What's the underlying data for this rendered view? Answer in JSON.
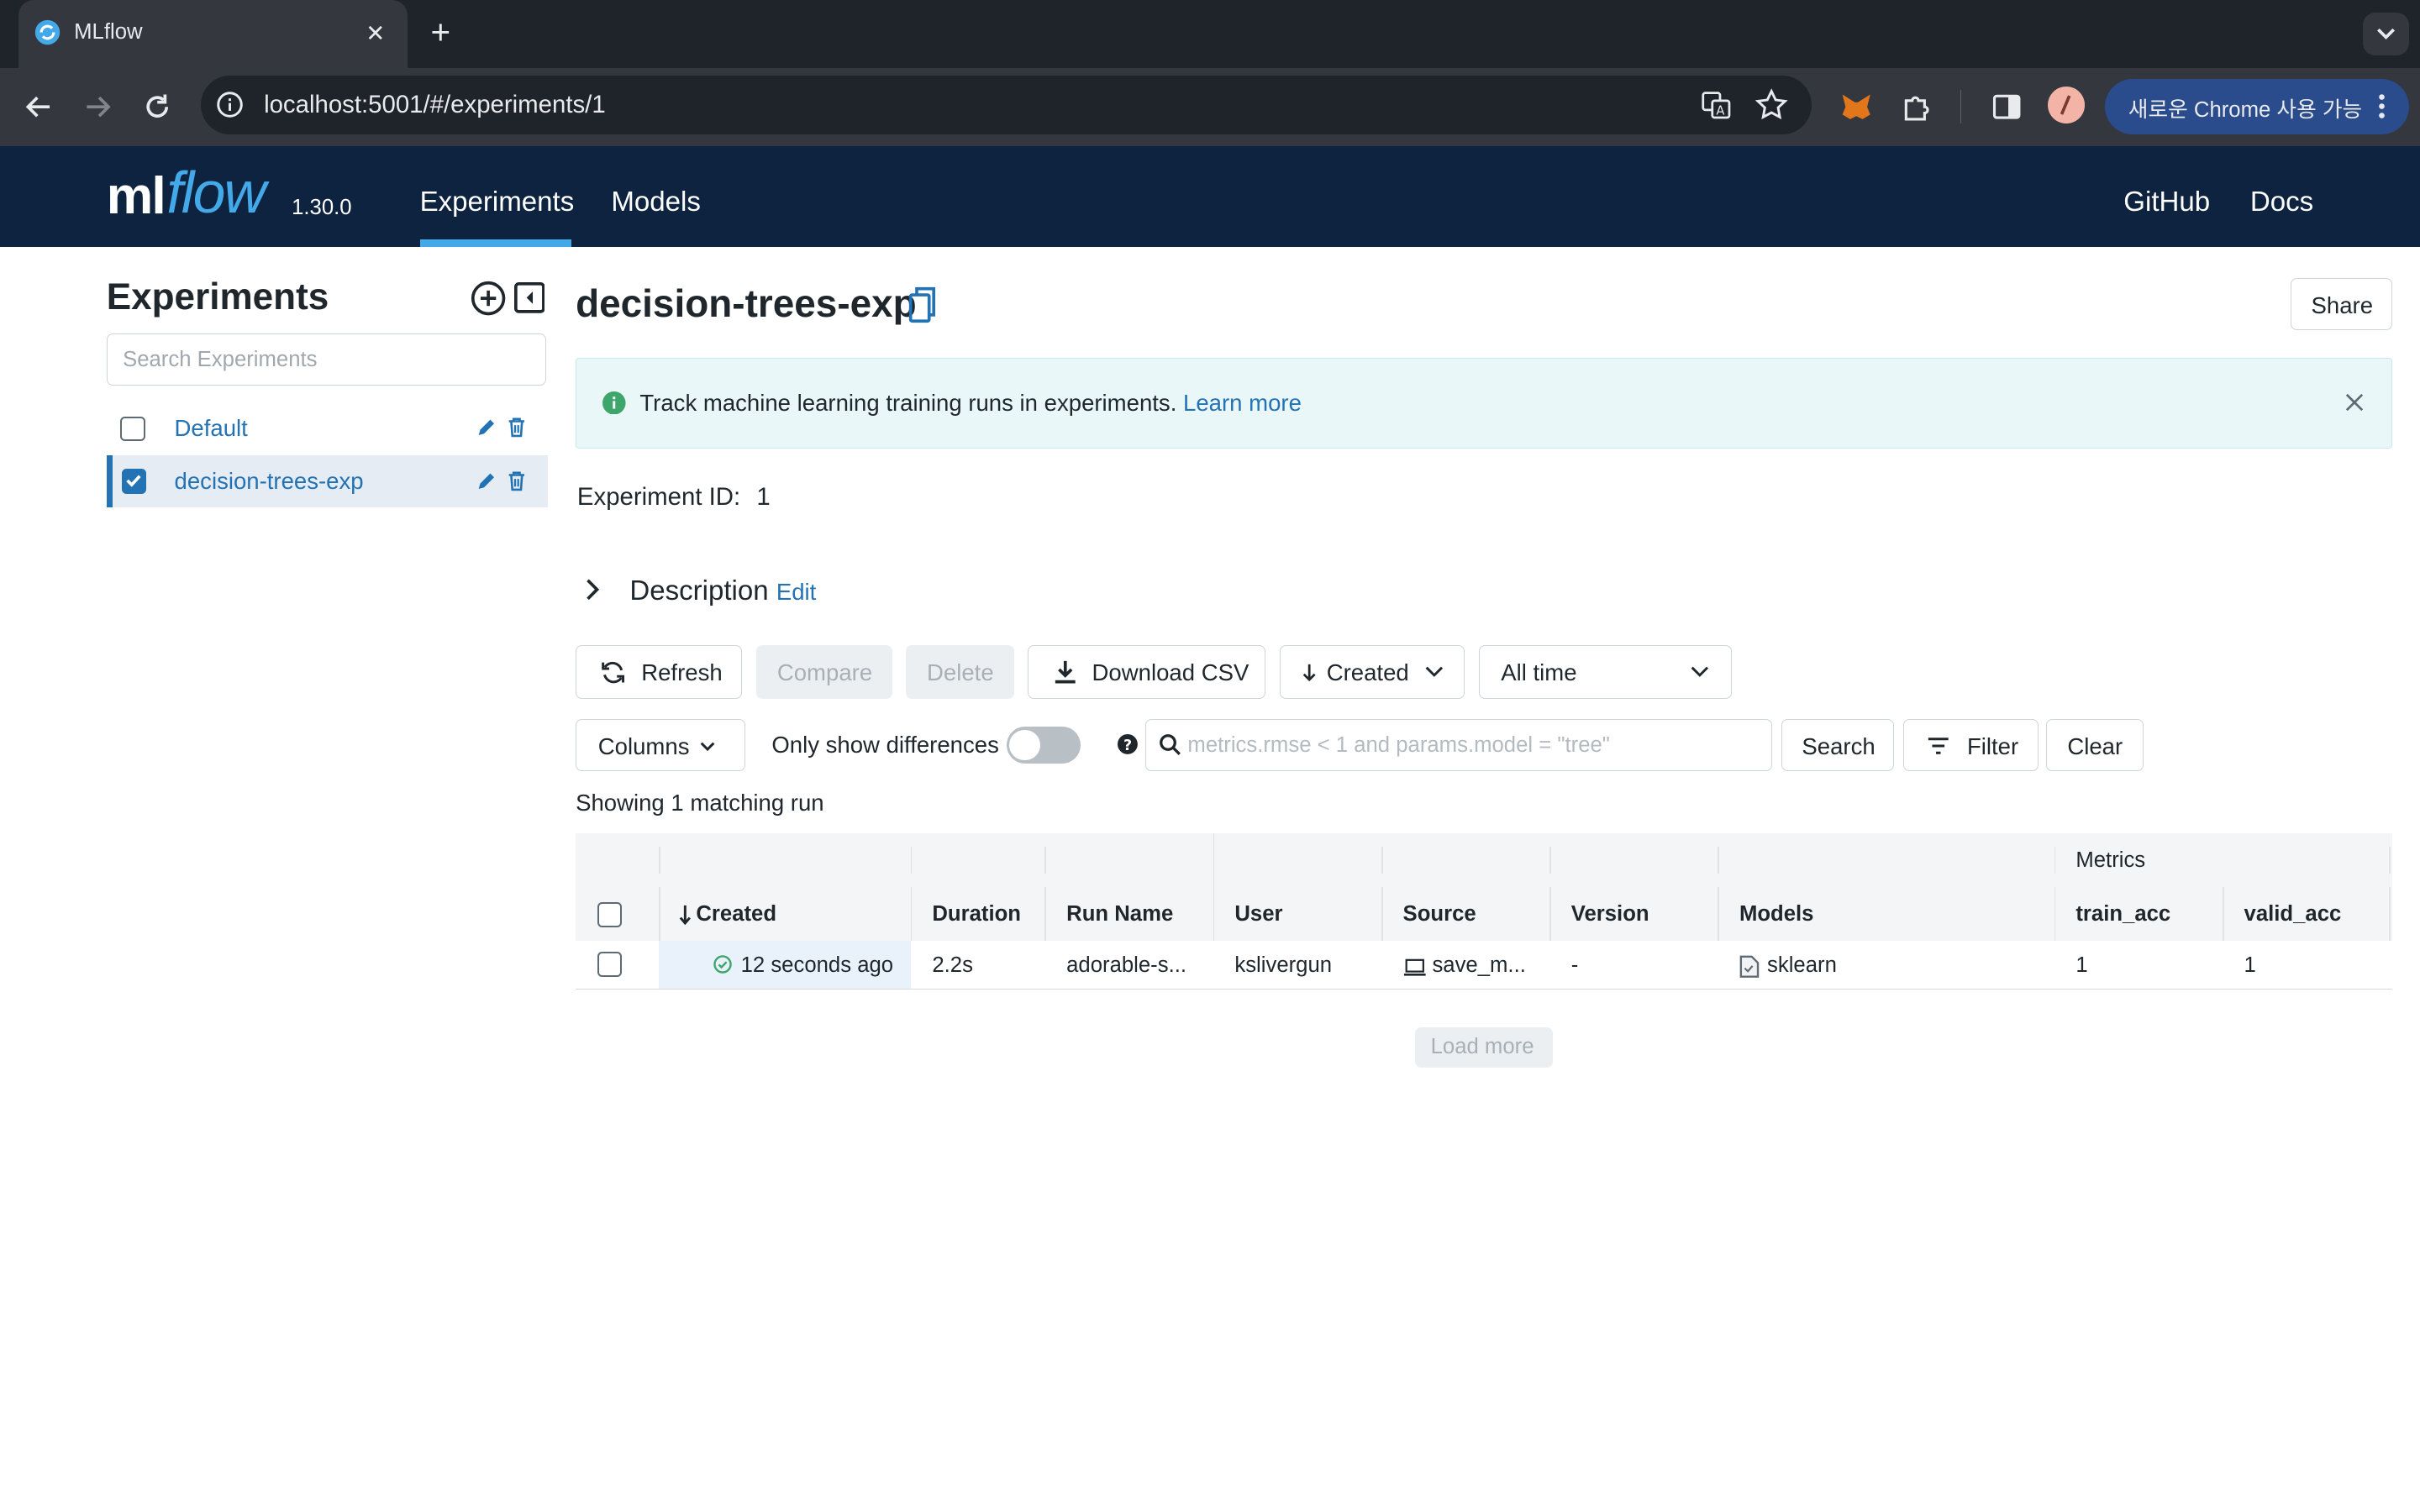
{
  "browser": {
    "tab_title": "MLflow",
    "url": "localhost:5001/#/experiments/1",
    "chrome_notice": "새로운 Chrome 사용 가능"
  },
  "header": {
    "logo_text_ml": "ml",
    "logo_text_flow": "flow",
    "version": "1.30.0",
    "nav": {
      "experiments": "Experiments",
      "models": "Models",
      "github": "GitHub",
      "docs": "Docs"
    },
    "bg_color": "#0e2340",
    "accent_color": "#43a9e8"
  },
  "sidebar": {
    "title": "Experiments",
    "search_placeholder": "Search Experiments",
    "items": [
      {
        "label": "Default",
        "checked": false
      },
      {
        "label": "decision-trees-exp",
        "checked": true
      }
    ]
  },
  "main": {
    "title": "decision-trees-exp",
    "share_label": "Share",
    "banner": {
      "text": "Track machine learning training runs in experiments.",
      "link": "Learn more"
    },
    "experiment_id_label": "Experiment ID:",
    "experiment_id": "1",
    "description_label": "Description",
    "description_edit": "Edit",
    "actions": {
      "refresh": "Refresh",
      "compare": "Compare",
      "delete": "Delete",
      "download_csv": "Download CSV",
      "sort": "Created",
      "time_range": "All time"
    },
    "filters": {
      "columns": "Columns",
      "only_diff": "Only show differences",
      "only_diff_on": false,
      "search_placeholder": "metrics.rmse < 1 and params.model = \"tree\"",
      "search": "Search",
      "filter": "Filter",
      "clear": "Clear"
    },
    "showing": "Showing 1 matching run",
    "table": {
      "group_header": "Metrics",
      "columns": [
        "Created",
        "Duration",
        "Run Name",
        "User",
        "Source",
        "Version",
        "Models",
        "train_acc",
        "valid_acc"
      ],
      "rows": [
        {
          "created": "12 seconds ago",
          "duration": "2.2s",
          "run_name": "adorable-s...",
          "user": "kslivergun",
          "source": "save_m...",
          "version": "-",
          "models": "sklearn",
          "train_acc": "1",
          "valid_acc": "1"
        }
      ]
    },
    "load_more": "Load more"
  }
}
